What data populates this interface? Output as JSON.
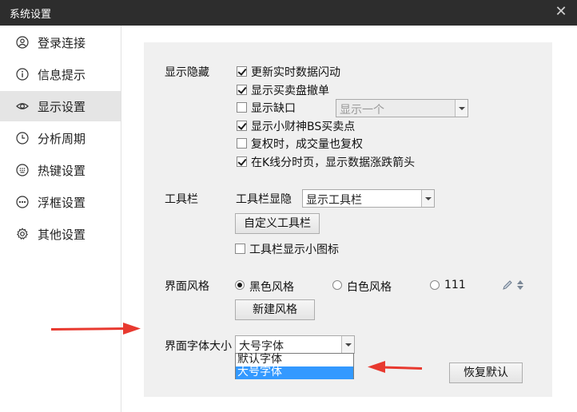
{
  "window": {
    "title": "系统设置",
    "close_glyph": "✕"
  },
  "sidebar": {
    "items": [
      {
        "label": "登录连接",
        "icon": "user-icon"
      },
      {
        "label": "信息提示",
        "icon": "info-icon"
      },
      {
        "label": "显示设置",
        "icon": "eye-icon",
        "active": true
      },
      {
        "label": "分析周期",
        "icon": "clock-icon"
      },
      {
        "label": "热键设置",
        "icon": "keypad-icon"
      },
      {
        "label": "浮框设置",
        "icon": "dots-icon"
      },
      {
        "label": "其他设置",
        "icon": "gear-icon"
      }
    ]
  },
  "display": {
    "label": "显示隐藏",
    "options": [
      {
        "label": "更新实时数据闪动",
        "checked": true
      },
      {
        "label": "显示买卖盘撤单",
        "checked": true
      },
      {
        "label": "显示缺口",
        "checked": false
      },
      {
        "label": "显示小财神BS买卖点",
        "checked": true
      },
      {
        "label": "复权时，成交量也复权",
        "checked": false
      },
      {
        "label": "在K线分时页，显示数据涨跌箭头",
        "checked": true
      }
    ],
    "gap_select_value": "显示一个"
  },
  "toolbar": {
    "label": "工具栏",
    "visibility_label": "工具栏显隐",
    "visibility_value": "显示工具栏",
    "customize_button": "自定义工具栏",
    "small_icon_label": "工具栏显示小图标",
    "small_icon_checked": false
  },
  "style": {
    "label": "界面风格",
    "options": [
      {
        "label": "黑色风格",
        "selected": true
      },
      {
        "label": "白色风格",
        "selected": false
      },
      {
        "label": "111",
        "selected": false
      }
    ],
    "new_button": "新建风格"
  },
  "font": {
    "label": "界面字体大小",
    "value": "大号字体",
    "dropdown_options": [
      "默认字体",
      "大号字体"
    ],
    "highlighted_option": "大号字体"
  },
  "restore_button": "恢复默认",
  "colors": {
    "accent_red": "#e8392f",
    "highlight_blue": "#3399ff"
  }
}
